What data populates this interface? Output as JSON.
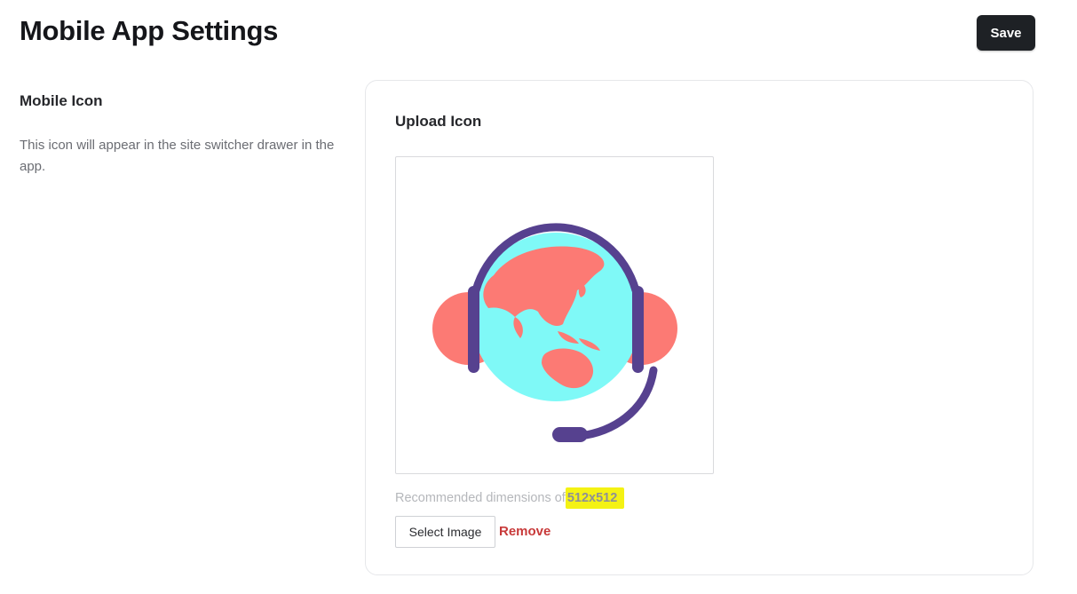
{
  "header": {
    "title": "Mobile App Settings",
    "save_label": "Save"
  },
  "section": {
    "heading": "Mobile Icon",
    "description": "This icon will appear in the site switcher drawer in the app."
  },
  "upload": {
    "heading": "Upload Icon",
    "hint_prefix": "Recommended dimensions of",
    "hint_dimensions": "512x512",
    "select_label": "Select Image",
    "remove_label": "Remove",
    "preview_icon": "globe-headset-icon",
    "colors": {
      "headset": "#56418f",
      "ocean": "#7ff9f7",
      "land": "#fc7a74",
      "highlight": "#f4f214",
      "remove": "#c83a3a",
      "save_bg": "#1e2125"
    }
  }
}
